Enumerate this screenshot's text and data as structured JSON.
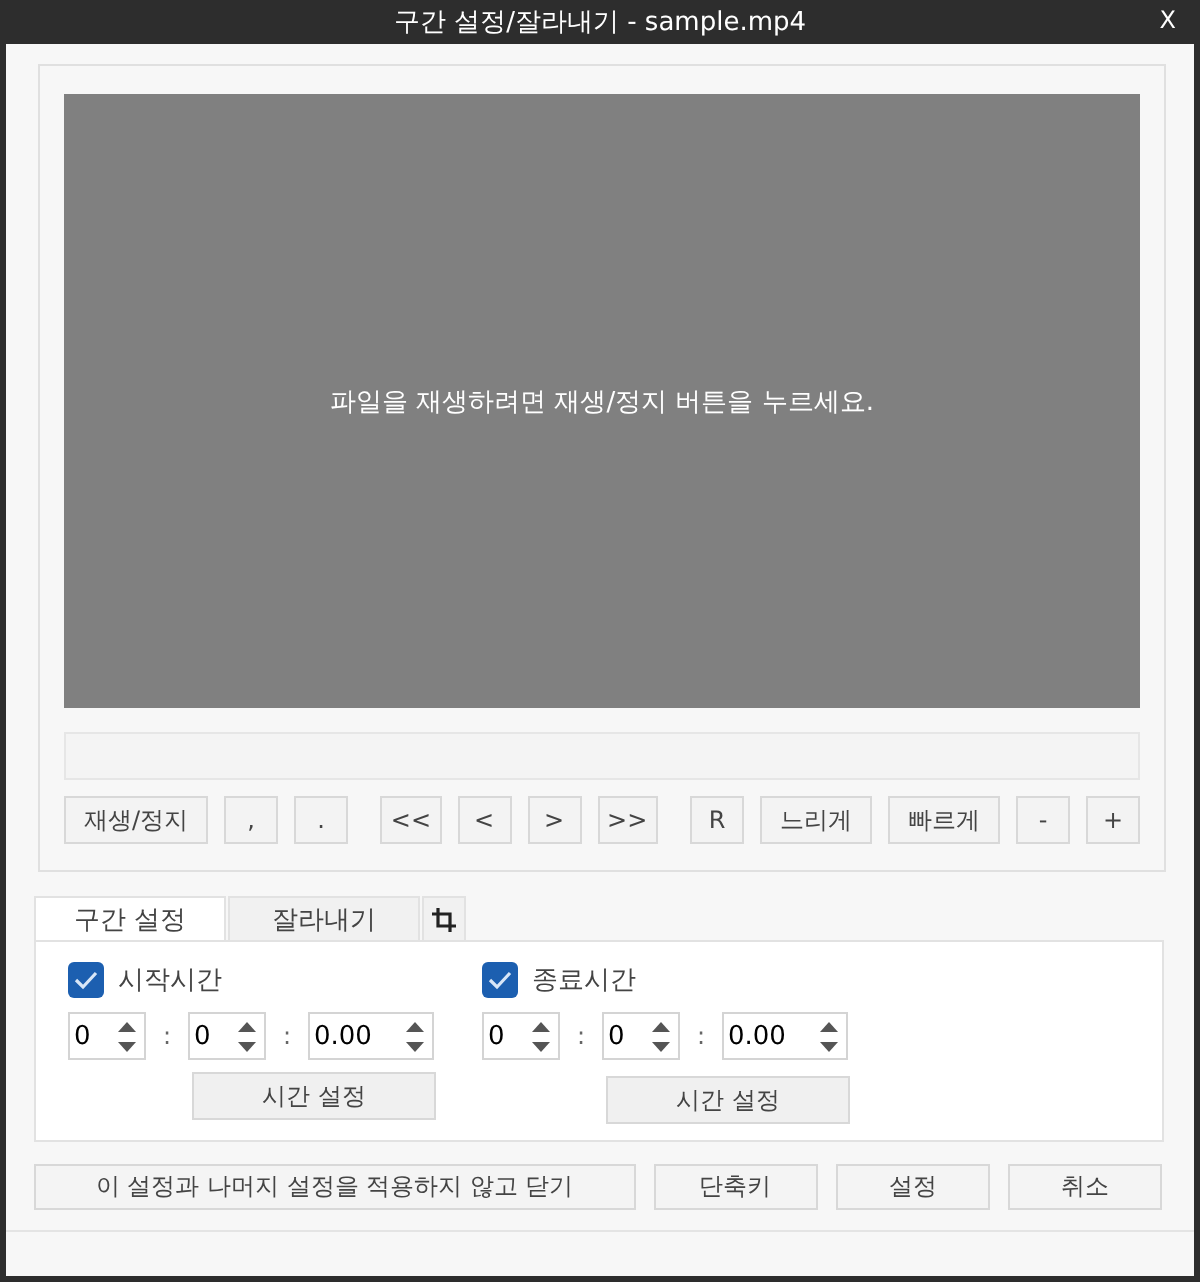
{
  "window": {
    "title": "구간 설정/잘라내기 - sample.mp4",
    "close": "X"
  },
  "player": {
    "message": "파일을 재생하려면 재생/정지 버튼을 누르세요.",
    "button_groups": [
      [
        "재생/정지",
        ",",
        "."
      ],
      [
        "<<",
        "<",
        ">",
        ">>"
      ],
      [
        "R",
        "느리게",
        "빠르게",
        "-",
        "+"
      ]
    ]
  },
  "tabs": [
    {
      "kind": "text",
      "label": "구간 설정",
      "selected": true
    },
    {
      "kind": "text",
      "label": "잘라내기",
      "selected": false
    },
    {
      "kind": "crop",
      "selected": false
    }
  ],
  "time_groups": [
    {
      "label": "시작시간",
      "checked": true,
      "hours": "0",
      "separator_1": ":",
      "minutes": "0",
      "separator_2": ":",
      "seconds": "0.00",
      "button": "시간 설정"
    },
    {
      "label": "종료시간",
      "checked": true,
      "hours": "0",
      "separator_1": ":",
      "minutes": "0",
      "separator_2": ":",
      "seconds": "0.00",
      "button": "시간 설정"
    }
  ],
  "footer_buttons": [
    "이 설정과 나머지 설정을 적용하지 않고 닫기",
    "단축키",
    "설정",
    "취소"
  ]
}
